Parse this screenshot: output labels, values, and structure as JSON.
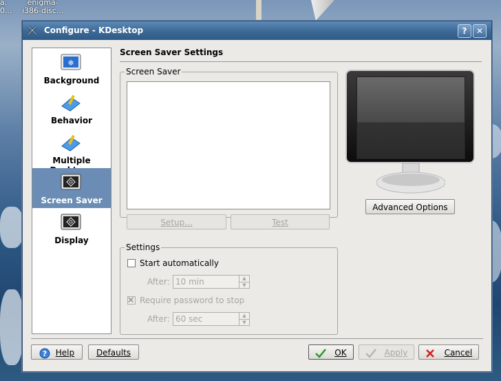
{
  "desktop": {
    "icon1_label": "a.\n0...",
    "icon2_label": "enigma-\ni386-disc..."
  },
  "window": {
    "title": "Configure - KDesktop",
    "help_button": "?",
    "close_button": "✕"
  },
  "sidebar": {
    "items": [
      {
        "label": "Background",
        "icon": "background-icon"
      },
      {
        "label": "Behavior",
        "icon": "behavior-icon"
      },
      {
        "label": "Multiple Desktops",
        "icon": "multiple-desktops-icon"
      },
      {
        "label": "Screen Saver",
        "icon": "screen-saver-icon",
        "selected": true
      },
      {
        "label": "Display",
        "icon": "display-icon"
      }
    ]
  },
  "main": {
    "heading": "Screen Saver Settings",
    "screensaver_group": {
      "label": "Screen Saver",
      "setup_button": "Setup...",
      "test_button": "Test"
    },
    "settings_group": {
      "label": "Settings",
      "start_auto_label": "Start automatically",
      "start_auto_checked": false,
      "after_label_1": "After:",
      "after_value_1": "10 min",
      "require_password_label": "Require password to stop",
      "require_password_checked": true,
      "after_label_2": "After:",
      "after_value_2": "60 sec"
    },
    "advanced_button": "Advanced Options"
  },
  "footer": {
    "help_button": "Help",
    "defaults_button": "Defaults",
    "ok_button": "OK",
    "apply_button": "Apply",
    "cancel_button": "Cancel"
  },
  "colors": {
    "titlebar": "#3d6a97",
    "selection": "#6b8db5"
  }
}
